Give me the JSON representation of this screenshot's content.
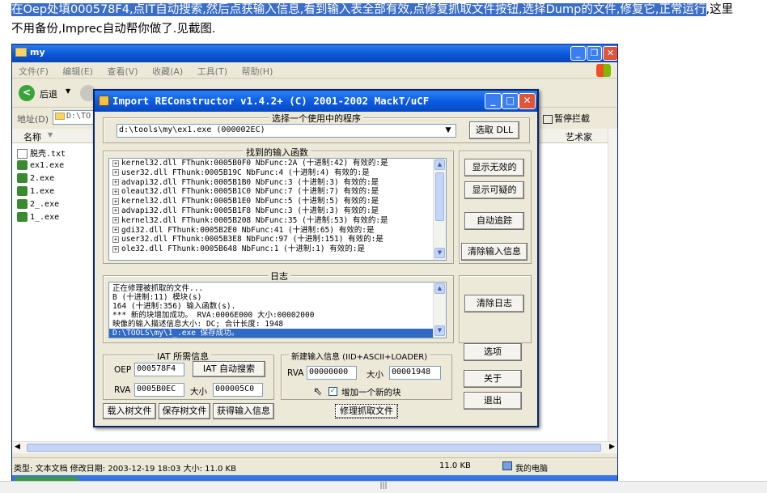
{
  "caption": {
    "highlighted": "在Oep处填000578F4,点IT自动搜索,然后点获输入信息,看到输入表全部有效,点修复抓取文件按钮,选择Dump的文件,修复它,正常运行",
    "rest_line1": ",这里",
    "line2": "不用备份,Imprec自动帮你做了.见截图."
  },
  "explorer": {
    "title": "my",
    "menu": [
      "文件(F)",
      "编辑(E)",
      "查看(V)",
      "收藏(A)",
      "工具(T)",
      "帮助(H)"
    ],
    "back_label": "后退",
    "address_label": "地址(D)",
    "address_value": "D:\\TO",
    "pause_block": "暂停拦截",
    "col_name": "名称",
    "col_artist": "艺术家",
    "files": [
      "脱壳.txt",
      "ex1.exe",
      "2.exe",
      "1.exe",
      "2_.exe",
      "1_.exe"
    ],
    "status_text": "类型: 文本文档 修改日期: 2003-12-19 18:03 大小: 11.0 KB",
    "status_size": "11.0 KB",
    "status_computer": "我的电脑"
  },
  "dialog": {
    "title": "Import REConstructor v1.4.2+  (C) 2001-2002 MackT/uCF",
    "process_group": "选择一个使用中的程序",
    "process_value": "d:\\tools\\my\\ex1.exe (000002EC)",
    "pick_dll": "选取 DLL",
    "imports_group": "找到的输入函数",
    "imports": [
      "kernel32.dll FThunk:0005B0F0 NbFunc:2A (十进制:42) 有效的:是",
      "user32.dll FThunk:0005B19C NbFunc:4 (十进制:4) 有效的:是",
      "advapi32.dll FThunk:0005B1B0 NbFunc:3 (十进制:3) 有效的:是",
      "oleaut32.dll FThunk:0005B1C0 NbFunc:7 (十进制:7) 有效的:是",
      "kernel32.dll FThunk:0005B1E0 NbFunc:5 (十进制:5) 有效的:是",
      "advapi32.dll FThunk:0005B1F8 NbFunc:3 (十进制:3) 有效的:是",
      "kernel32.dll FThunk:0005B208 NbFunc:35 (十进制:53) 有效的:是",
      "gdi32.dll FThunk:0005B2E0 NbFunc:41 (十进制:65) 有效的:是",
      "user32.dll FThunk:0005B3E8 NbFunc:97 (十进制:151) 有效的:是",
      "ole32.dll FThunk:0005B648 NbFunc:1 (十进制:1) 有效的:是"
    ],
    "show_invalid": "显示无效的",
    "show_suspect": "显示可疑的",
    "auto_trace": "自动追踪",
    "clear_imports": "清除输入信息",
    "log_group": "日志",
    "log": [
      "正在修理被抓取的文件...",
      "B (十进制:11) 模块(s)",
      "164 (十进制:356) 输入函数(s).",
      "*** 新的块增加成功。 RVA:0006E000 大小:00002000",
      "映像的输入描述信息大小: DC; 合计长度: 1948",
      "D:\\TOOLS\\my\\1_.exe 保存成功。"
    ],
    "clear_log": "清除日志",
    "iat_group": "IAT 所需信息",
    "oep_label": "OEP",
    "oep_value": "000578F4",
    "iat_autosearch": "IAT 自动搜索",
    "rva_label": "RVA",
    "rva_value": "0005B0EC",
    "size_label": "大小",
    "size_value": "000005C0",
    "load_tree": "载入树文件",
    "save_tree": "保存树文件",
    "get_imports": "获得输入信息",
    "new_import_group": "新建输入信息 (IID+ASCII+LOADER)",
    "new_rva_label": "RVA",
    "new_rva_value": "00000000",
    "new_size_label": "大小",
    "new_size_value": "00001948",
    "add_section": "增加一个新的块",
    "fix_dump": "修理抓取文件",
    "options": "选项",
    "about": "关于",
    "exit": "退出"
  },
  "colors": {
    "xp_title": "#0a55d6",
    "selection": "#316ac5",
    "caption_highlight": "#3b6ec8"
  }
}
